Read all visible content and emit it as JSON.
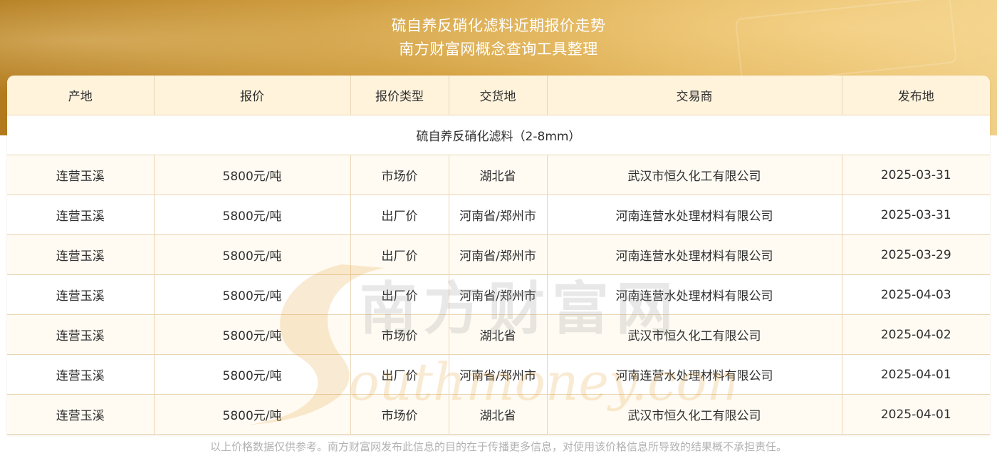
{
  "header": {
    "title_line1": "硫自养反硝化滤料近期报价走势",
    "title_line2": "南方财富网概念查询工具整理"
  },
  "table": {
    "columns": [
      "产地",
      "报价",
      "报价类型",
      "交货地",
      "交易商",
      "发布地"
    ],
    "product_row": "硫自养反硝化滤料（2-8mm）",
    "rows": [
      [
        "连营玉溪",
        "5800元/吨",
        "市场价",
        "湖北省",
        "武汉市恒久化工有限公司",
        "2025-03-31"
      ],
      [
        "连营玉溪",
        "5800元/吨",
        "出厂价",
        "河南省/郑州市",
        "河南连营水处理材料有限公司",
        "2025-03-31"
      ],
      [
        "连营玉溪",
        "5800元/吨",
        "出厂价",
        "河南省/郑州市",
        "河南连营水处理材料有限公司",
        "2025-03-29"
      ],
      [
        "连营玉溪",
        "5800元/吨",
        "出厂价",
        "河南省/郑州市",
        "河南连营水处理材料有限公司",
        "2025-04-03"
      ],
      [
        "连营玉溪",
        "5800元/吨",
        "市场价",
        "湖北省",
        "武汉市恒久化工有限公司",
        "2025-04-02"
      ],
      [
        "连营玉溪",
        "5800元/吨",
        "出厂价",
        "河南省/郑州市",
        "河南连营水处理材料有限公司",
        "2025-04-01"
      ],
      [
        "连营玉溪",
        "5800元/吨",
        "市场价",
        "湖北省",
        "武汉市恒久化工有限公司",
        "2025-04-01"
      ]
    ]
  },
  "watermark": {
    "cn_text": "南方财富网",
    "en_text": "Southmoney.com"
  },
  "footer": {
    "disclaimer": "以上价格数据仅供参考。南方财富网发布此信息的目的在于传播更多信息，对使用该价格信息所导致的结果概不承担责任。"
  },
  "colors": {
    "banner_start": "#b27a1c",
    "banner_end": "#f0cf86",
    "header_bg": "#fff3dc",
    "border": "#ead5b3",
    "watermark": "#e8a23a"
  }
}
